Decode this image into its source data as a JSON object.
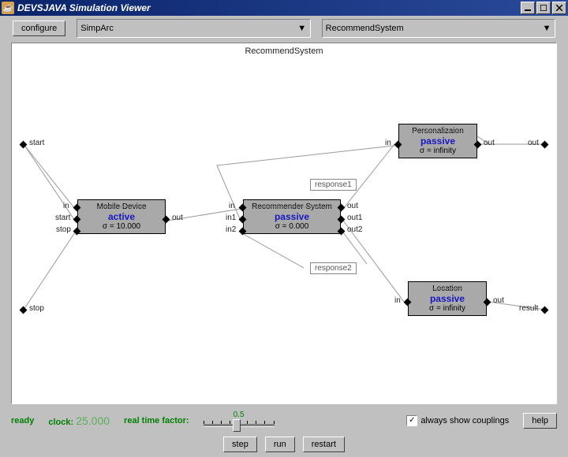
{
  "title": "DEVSJAVA Simulation Viewer",
  "toolbar": {
    "configure": "configure",
    "pkg": "SimpArc",
    "model": "RecommendSystem"
  },
  "canvas": {
    "title": "RecommendSystem",
    "outerPorts": {
      "start": "start",
      "stop": "stop",
      "out": "out",
      "result": "result"
    },
    "nodes": {
      "mobile": {
        "name": "Mobile Device",
        "state": "active",
        "sigma": "σ = 10.000",
        "ports": {
          "in": "in",
          "start": "start",
          "stop": "stop",
          "out": "out"
        }
      },
      "recommender": {
        "name": "Recommender System",
        "state": "passive",
        "sigma": "σ = 0.000",
        "ports": {
          "in": "in",
          "in1": "in1",
          "in2": "in2",
          "out": "out",
          "out1": "out1",
          "out2": "out2"
        }
      },
      "personal": {
        "name": "Personalizaion",
        "state": "passive",
        "sigma": "σ = infinity",
        "ports": {
          "in": "in",
          "out": "out"
        }
      },
      "location": {
        "name": "Location",
        "state": "passive",
        "sigma": "σ = infinity",
        "ports": {
          "in": "in",
          "out": "out"
        }
      }
    },
    "messages": {
      "r1": "response1",
      "r2": "response2"
    }
  },
  "status": {
    "ready": "ready",
    "clockLabel": "clock:",
    "clockVal": "25.000",
    "rtf": "real time factor:",
    "sliderVal": "0.5",
    "alwaysShow": "always show couplings",
    "help": "help"
  },
  "controls": {
    "step": "step",
    "run": "run",
    "restart": "restart"
  }
}
